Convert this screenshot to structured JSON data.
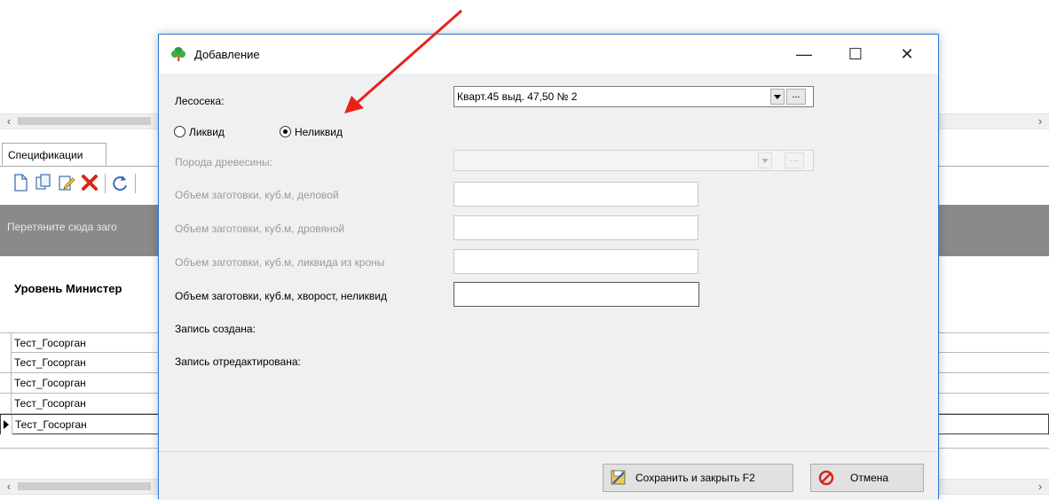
{
  "background": {
    "tab_label": "Спецификации",
    "group_panel_text": "Перетяните сюда заго",
    "column_header": "Уровень Министер",
    "rows": [
      "Тест_Госорган",
      "Тест_Госорган",
      "Тест_Госорган",
      "Тест_Госорган",
      "Тест_Госорган"
    ],
    "scroll_left_arrow": "‹",
    "scroll_right_arrow": "›"
  },
  "dialog": {
    "title": "Добавление",
    "window_buttons": {
      "minimize": "—",
      "maximize": "☐",
      "close": "✕"
    },
    "lesoseka_label": "Лесосека:",
    "lesoseka_value": "Кварт.45 выд. 47,50 № 2",
    "ellipsis": "...",
    "radio_likvid": "Ликвид",
    "radio_nelikvid": "Неликвид",
    "selected_radio": "Неликвид",
    "poroda_label": "Порода древесины:",
    "vol_delovoy_label": "Объем заготовки, куб.м, деловой",
    "vol_drovyanoy_label": "Объем заготовки, куб.м, дровяной",
    "vol_krona_label": "Объем заготовки, куб.м, ликвида из кроны",
    "vol_khvorost_label": "Объем заготовки, куб.м, хворост, неликвид",
    "created_label": "Запись создана:",
    "edited_label": "Запись отредактирована:",
    "save_button": "Сохранить и закрыть F2",
    "cancel_button": "Отмена"
  },
  "colors": {
    "annotation_arrow": "#e8221b",
    "dialog_border": "#2b79d8",
    "group_panel": "#8a8a8a"
  }
}
